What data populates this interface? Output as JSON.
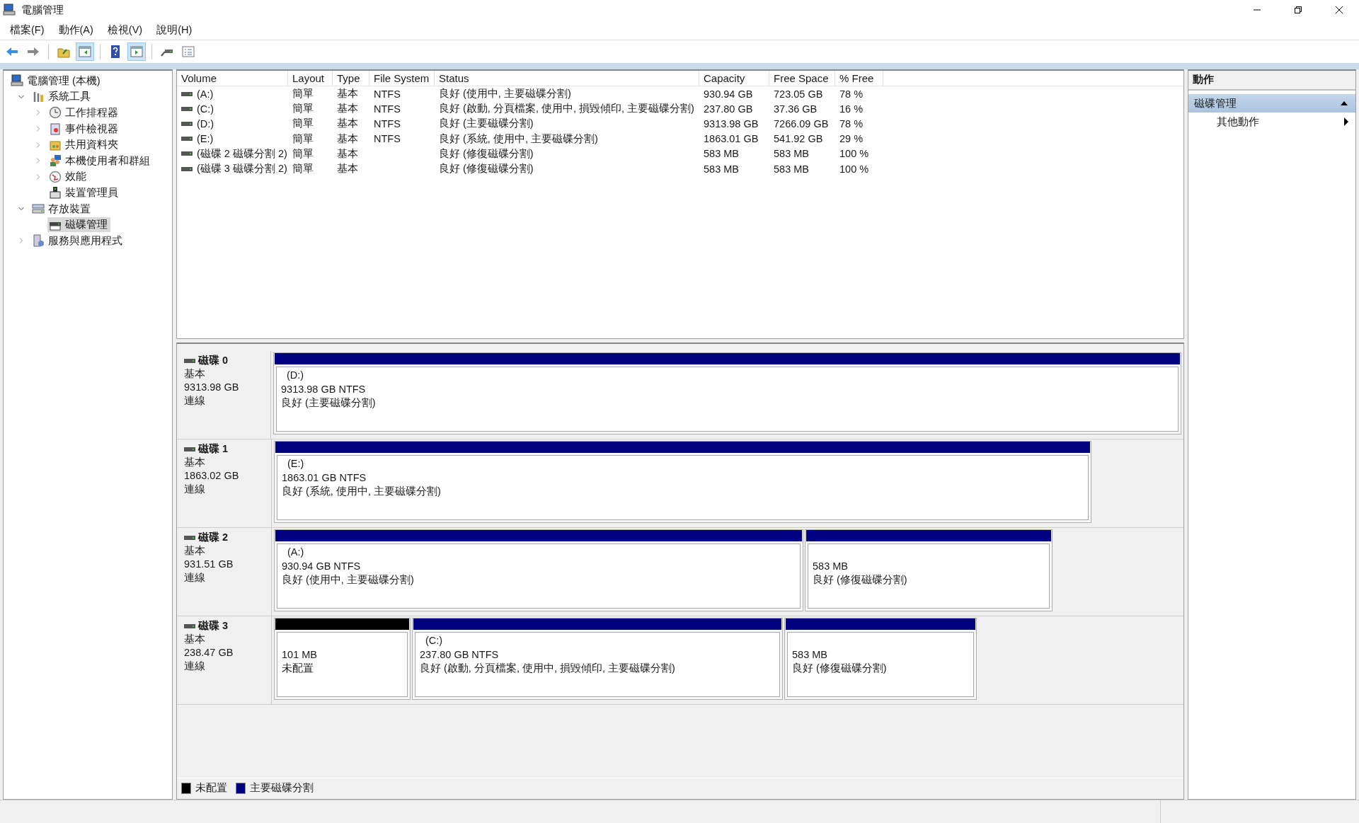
{
  "window": {
    "title": "電腦管理"
  },
  "menu": [
    "檔案(F)",
    "動作(A)",
    "檢視(V)",
    "說明(H)"
  ],
  "toolbar": [
    {
      "pressed": false
    },
    {
      "pressed": false
    },
    {
      "pressed": false
    },
    {
      "pressed": true
    },
    {
      "pressed": false
    },
    {
      "pressed": true
    },
    {
      "pressed": false
    },
    {
      "pressed": false
    }
  ],
  "tree": [
    {
      "label": "電腦管理 (本機)",
      "selected": false,
      "children": [
        {
          "label": "系統工具",
          "selected": false,
          "expanded": true,
          "children": [
            {
              "label": "工作排程器",
              "selected": false,
              "expanded": false
            },
            {
              "label": "事件檢視器",
              "selected": false,
              "expanded": false
            },
            {
              "label": "共用資料夾",
              "selected": false,
              "expanded": false
            },
            {
              "label": "本機使用者和群組",
              "selected": false,
              "expanded": false
            },
            {
              "label": "效能",
              "selected": false,
              "expanded": false
            },
            {
              "label": "裝置管理員",
              "selected": false
            }
          ]
        },
        {
          "label": "存放裝置",
          "selected": false,
          "expanded": true,
          "children": [
            {
              "label": "磁碟管理",
              "selected": true
            }
          ]
        },
        {
          "label": "服務與應用程式",
          "selected": false,
          "expanded": false
        }
      ]
    }
  ],
  "volumes": {
    "columns": [
      "Volume",
      "Layout",
      "Type",
      "File System",
      "Status",
      "Capacity",
      "Free Space",
      "% Free"
    ],
    "rows": [
      {
        "volume": "(A:)",
        "layout": "簡單",
        "type": "基本",
        "file_system": "NTFS",
        "status": "良好 (使用中, 主要磁碟分割)",
        "capacity": "930.94 GB",
        "free_space": "723.05 GB",
        "percent_free": "78 %"
      },
      {
        "volume": "(C:)",
        "layout": "簡單",
        "type": "基本",
        "file_system": "NTFS",
        "status": "良好 (啟動, 分頁檔案, 使用中, 損毀傾印, 主要磁碟分割)",
        "capacity": "237.80 GB",
        "free_space": "37.36 GB",
        "percent_free": "16 %"
      },
      {
        "volume": "(D:)",
        "layout": "簡單",
        "type": "基本",
        "file_system": "NTFS",
        "status": "良好 (主要磁碟分割)",
        "capacity": "9313.98 GB",
        "free_space": "7266.09 GB",
        "percent_free": "78 %"
      },
      {
        "volume": "(E:)",
        "layout": "簡單",
        "type": "基本",
        "file_system": "NTFS",
        "status": "良好 (系統, 使用中, 主要磁碟分割)",
        "capacity": "1863.01 GB",
        "free_space": "541.92 GB",
        "percent_free": "29 %"
      },
      {
        "volume": "(磁碟 2 磁碟分割 2)",
        "layout": "簡單",
        "type": "基本",
        "status": "良好 (修復磁碟分割)",
        "capacity": "583 MB",
        "free_space": "583 MB",
        "percent_free": "100 %"
      },
      {
        "volume": "(磁碟 3 磁碟分割 2)",
        "layout": "簡單",
        "type": "基本",
        "status": "良好 (修復磁碟分割)",
        "capacity": "583 MB",
        "free_space": "583 MB",
        "percent_free": "100 %"
      }
    ]
  },
  "disks": [
    {
      "name": "磁碟 0",
      "type": "基本",
      "size": "9313.98 GB",
      "state": "連線",
      "partitions": [
        {
          "kind": "primary",
          "label": "(D:)",
          "size": "9313.98 GB NTFS",
          "status": "良好 (主要磁碟分割)"
        }
      ]
    },
    {
      "name": "磁碟 1",
      "type": "基本",
      "size": "1863.02 GB",
      "state": "連線",
      "partitions": [
        {
          "kind": "primary",
          "label": "(E:)",
          "size": "1863.01 GB NTFS",
          "status": "良好 (系統, 使用中, 主要磁碟分割)"
        }
      ]
    },
    {
      "name": "磁碟 2",
      "type": "基本",
      "size": "931.51 GB",
      "state": "連線",
      "partitions": [
        {
          "kind": "primary",
          "label": "(A:)",
          "size": "930.94 GB NTFS",
          "status": "良好 (使用中, 主要磁碟分割)"
        },
        {
          "kind": "primary",
          "size": "583 MB",
          "status": "良好 (修復磁碟分割)"
        }
      ]
    },
    {
      "name": "磁碟 3",
      "type": "基本",
      "size": "238.47 GB",
      "state": "連線",
      "partitions": [
        {
          "kind": "unallocated",
          "size": "101 MB",
          "status": "未配置"
        },
        {
          "kind": "primary",
          "label": "(C:)",
          "size": "237.80 GB NTFS",
          "status": "良好 (啟動, 分頁檔案, 使用中, 損毀傾印, 主要磁碟分割)"
        },
        {
          "kind": "primary",
          "size": "583 MB",
          "status": "良好 (修復磁碟分割)"
        }
      ]
    }
  ],
  "legend": [
    {
      "label": "未配置",
      "color": "#000000"
    },
    {
      "label": "主要磁碟分割",
      "color": "#000080"
    }
  ],
  "actions": {
    "title": "動作",
    "sections": [
      {
        "label": "磁碟管理",
        "expanded": true,
        "items": [
          "其他動作"
        ]
      }
    ]
  }
}
